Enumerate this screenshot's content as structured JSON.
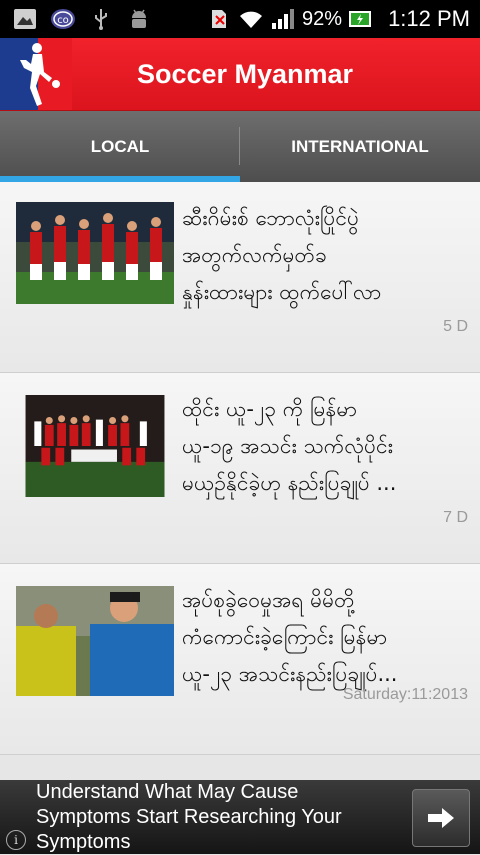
{
  "status_bar": {
    "battery": "92%",
    "time": "1:12 PM",
    "icons": [
      "screenshot-icon",
      "viber-icon",
      "usb-icon",
      "android-debug-icon",
      "no-sim-icon",
      "wifi-icon",
      "signal-icon",
      "battery-charging-icon"
    ]
  },
  "app": {
    "title": "Soccer Myanmar",
    "accent": "#e81a23",
    "tab_indicator_color": "#33a6e6"
  },
  "tabs": [
    {
      "label": "LOCAL",
      "selected": true
    },
    {
      "label": "INTERNATIONAL",
      "selected": false
    }
  ],
  "news": [
    {
      "title_lines": [
        "ဆီးဂိမ်းစ် ဘောလုံးပြိုင်ပွဲ",
        "အတွက်လက်မှတ်ခ",
        "နှုန်းထားများ ထွက်ပေါ်လာ"
      ],
      "date": "5 D"
    },
    {
      "title_lines": [
        "ထိုင်း ယူ-၂၃ ကို မြန်မာ",
        "ယူ-၁၉ အသင်း သက်လုံပိုင်း",
        "မယှဉ်နိုင်ခဲ့ဟု နည်းပြချုပ် ..."
      ],
      "date": "7 D"
    },
    {
      "title_lines": [
        "အုပ်စုခွဲဝေမှုအရ မိမိတို့",
        "ကံကောင်းခဲ့ကြောင်း မြန်မာ",
        "ယူ-၂၃ အသင်းနည်းပြချုပ်..."
      ],
      "date": "Saturday:11:2013"
    }
  ],
  "ad": {
    "text": "Understand What May Cause Symptoms Start Researching Your Symptoms",
    "info_icon": "i"
  }
}
